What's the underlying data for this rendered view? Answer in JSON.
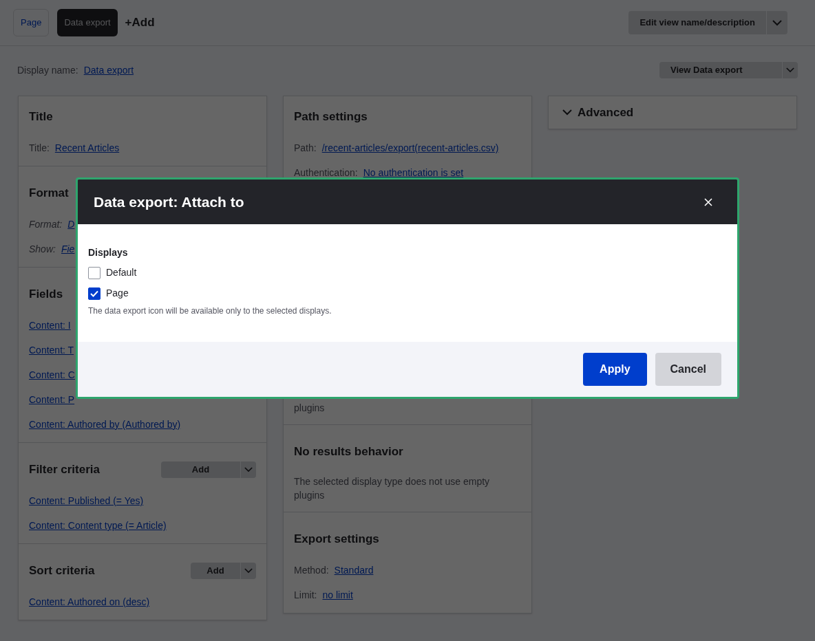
{
  "tabs": [
    {
      "label": "Page",
      "selected": false
    },
    {
      "label": "Data export",
      "selected": true
    }
  ],
  "add_display": "+Add",
  "edit_button": "Edit view name/description",
  "display_name": {
    "label": "Display name:",
    "value": "Data export"
  },
  "view_button": "View Data export",
  "left_column": [
    {
      "title": "Title",
      "items": [
        {
          "kind": "setting",
          "label": "Title:",
          "value": "Recent Articles",
          "italic": false
        }
      ]
    },
    {
      "title": "Format",
      "items": [
        {
          "kind": "setting",
          "label": "Format:",
          "value": "D",
          "italic": true
        },
        {
          "kind": "setting",
          "label": "Show:",
          "value": "Fie",
          "italic": true
        }
      ]
    },
    {
      "title": "Fields",
      "items": [
        {
          "kind": "link",
          "text": "Content: I"
        },
        {
          "kind": "link",
          "text": "Content: T"
        },
        {
          "kind": "link",
          "text": "Content: C"
        },
        {
          "kind": "link",
          "text": "Content: P"
        },
        {
          "kind": "link",
          "text": "Content: Authored by (Authored by)"
        }
      ]
    },
    {
      "title": "Filter criteria",
      "add_button": "Add",
      "items": [
        {
          "kind": "link",
          "text": "Content: Published (= Yes)"
        },
        {
          "kind": "link",
          "text": "Content: Content type (= Article)"
        }
      ]
    },
    {
      "title": "Sort criteria",
      "add_button": "Add",
      "items": [
        {
          "kind": "link",
          "text": "Content: Authored on (desc)"
        }
      ]
    }
  ],
  "middle_column": [
    {
      "title": "Path settings",
      "items": [
        {
          "kind": "setting",
          "label": "Path:",
          "value": "/recent-articles/export(recent-articles.csv)",
          "italic": false
        },
        {
          "kind": "setting",
          "label": "Authentication:",
          "value": "No authentication is set",
          "italic": false
        }
      ]
    },
    {
      "items": [
        {
          "kind": "note",
          "text": "plugins"
        }
      ]
    },
    {
      "title": "No results behavior",
      "items": [
        {
          "kind": "note",
          "text": "The selected display type does not use empty plugins"
        }
      ]
    },
    {
      "title": "Export settings",
      "items": [
        {
          "kind": "setting",
          "label": "Method:",
          "value": "Standard",
          "italic": false
        },
        {
          "kind": "setting",
          "label": "Limit:",
          "value": "no limit",
          "italic": false
        }
      ]
    }
  ],
  "advanced": {
    "title": "Advanced"
  },
  "dialog": {
    "title": "Data export: Attach to",
    "group_label": "Displays",
    "options": [
      {
        "label": "Default",
        "checked": false
      },
      {
        "label": "Page",
        "checked": true
      }
    ],
    "description": "The data export icon will be available only to the selected displays.",
    "buttons": [
      {
        "label": "Apply",
        "kind": "primary"
      },
      {
        "label": "Cancel",
        "kind": "secondary"
      }
    ]
  }
}
